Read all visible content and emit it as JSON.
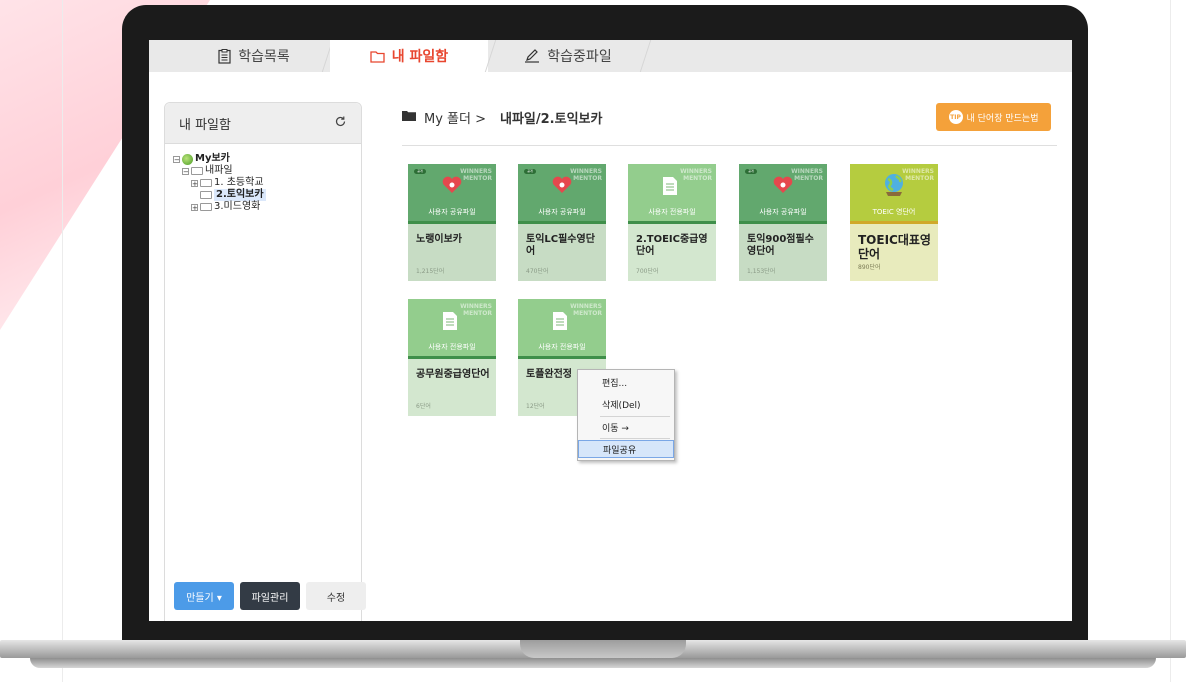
{
  "tabs": [
    {
      "label": "학습목록",
      "icon": "clipboard-icon"
    },
    {
      "label": "내 파일함",
      "icon": "folder-icon"
    },
    {
      "label": "학습중파일",
      "icon": "pencil-icon"
    }
  ],
  "sidebar": {
    "title": "내 파일함",
    "tree": {
      "root": "My보카",
      "folder": "내파일",
      "children": [
        "1. 초등학교",
        "2.토익보카",
        "3.미드영화"
      ]
    },
    "buttons": {
      "create": "만들기 ▾",
      "manage": "파일관리",
      "edit": "수정"
    }
  },
  "breadcrumb": {
    "prefix": "My 폴더 >",
    "path": "내파일/2.토익보카"
  },
  "tip_button": {
    "badge": "TIP",
    "label": "내 단어장 만드는법"
  },
  "watermark": {
    "line1": "WINNERS",
    "line2": "MENTOR"
  },
  "cards": [
    {
      "label": "사용자 공유파일",
      "title": "노랭이보카",
      "count": "1,215단어",
      "badge": "공개"
    },
    {
      "label": "사용자 공유파일",
      "title": "토익LC필수영단어",
      "count": "470단어",
      "badge": "공개"
    },
    {
      "label": "사용자 전용파일",
      "title": "2.TOEIC중급영단어",
      "count": "700단어"
    },
    {
      "label": "사용자 공유파일",
      "title": "토익900점필수영단어",
      "count": "1,153단어",
      "badge": "공개"
    },
    {
      "label": "TOEIC 영단어",
      "title": "TOEIC대표영단어",
      "count": "890단어"
    },
    {
      "label": "사용자 전용파일",
      "title": "공무원중급영단어",
      "count": "6단어"
    },
    {
      "label": "사용자 전용파일",
      "title": "토플완전정",
      "count": "12단어"
    }
  ],
  "context_menu": {
    "items": [
      "편집...",
      "삭제(Del)",
      "이동 →",
      "파일공유"
    ],
    "highlighted": "파일공유"
  },
  "colors": {
    "accent": "#e8462f",
    "tip": "#f4a13a",
    "shared_card": "#62a86e",
    "user_card": "#93cd8d",
    "toeic_card": "#b5cc3f"
  }
}
